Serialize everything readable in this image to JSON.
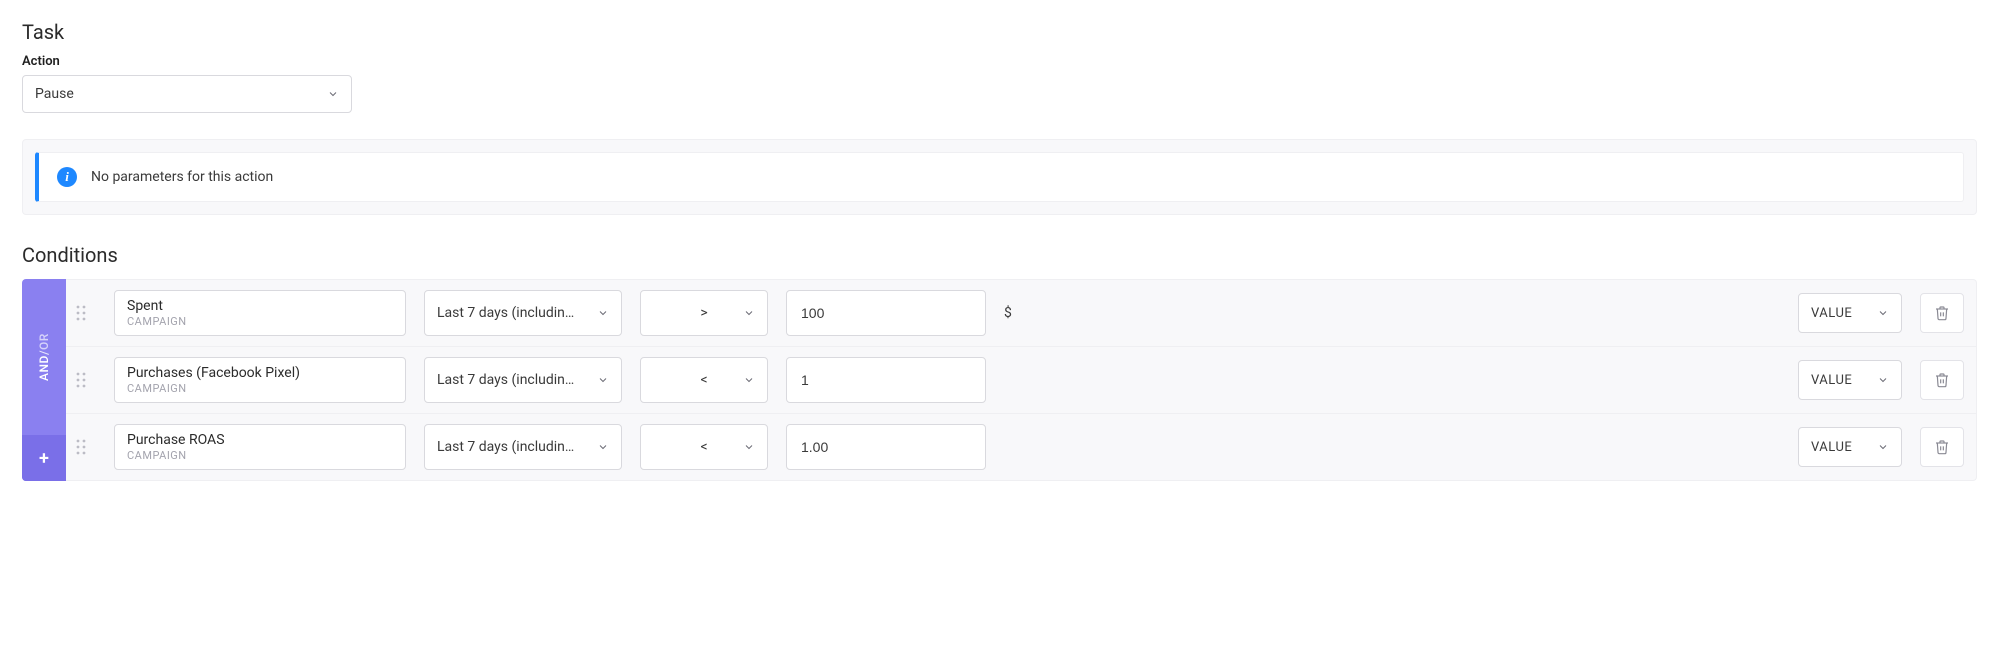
{
  "task": {
    "title": "Task",
    "action_label": "Action",
    "action_value": "Pause",
    "callout_text": "No parameters for this action"
  },
  "conditions": {
    "title": "Conditions",
    "logic_and": "AND",
    "logic_or": "OR",
    "add_symbol": "+",
    "rows": [
      {
        "metric": "Spent",
        "level": "CAMPAIGN",
        "period": "Last 7 days (includin…",
        "operator": ">",
        "value": "100",
        "unit": "$",
        "mode": "VALUE"
      },
      {
        "metric": "Purchases (Facebook Pixel)",
        "level": "CAMPAIGN",
        "period": "Last 7 days (includin…",
        "operator": "<",
        "value": "1",
        "unit": "",
        "mode": "VALUE"
      },
      {
        "metric": "Purchase ROAS",
        "level": "CAMPAIGN",
        "period": "Last 7 days (includin…",
        "operator": "<",
        "value": "1.00",
        "unit": "",
        "mode": "VALUE"
      }
    ]
  }
}
